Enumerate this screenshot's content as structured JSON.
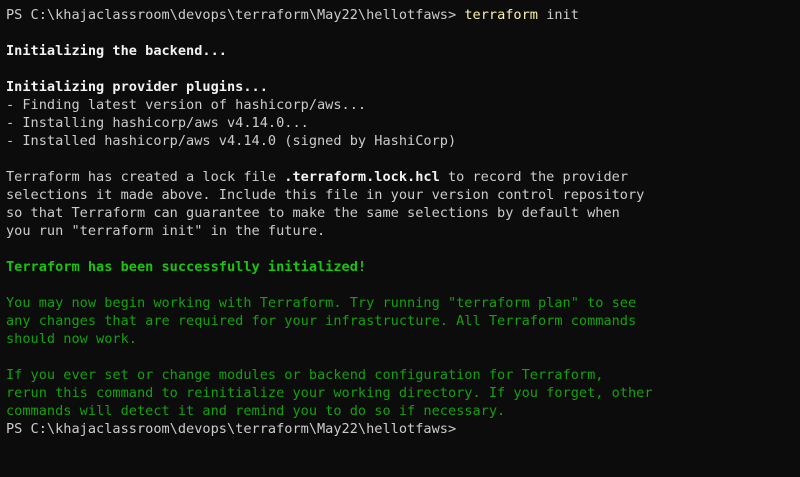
{
  "prompt1": "PS C:\\khajaclassroom\\devops\\terraform\\May22\\hellotfaws>",
  "command": "terraform",
  "command_args": "init",
  "init_backend": "Initializing the backend...",
  "init_provider": "Initializing provider plugins...",
  "finding": "- Finding latest version of hashicorp/aws...",
  "installing": "- Installing hashicorp/aws v4.14.0...",
  "installed": "- Installed hashicorp/aws v4.14.0 (signed by HashiCorp)",
  "lock_pre": "Terraform has created a lock file ",
  "lock_file": ".terraform.lock.hcl",
  "lock_post": " to record the provider",
  "lock2": "selections it made above. Include this file in your version control repository",
  "lock3": "so that Terraform can guarantee to make the same selections by default when",
  "lock4": "you run \"terraform init\" in the future.",
  "success": "Terraform has been successfully initialized!",
  "begin1": "You may now begin working with Terraform. Try running \"terraform plan\" to see",
  "begin2": "any changes that are required for your infrastructure. All Terraform commands",
  "begin3": "should now work.",
  "ever1": "If you ever set or change modules or backend configuration for Terraform,",
  "ever2": "rerun this command to reinitialize your working directory. If you forget, other",
  "ever3": "commands will detect it and remind you to do so if necessary.",
  "prompt2": "PS C:\\khajaclassroom\\devops\\terraform\\May22\\hellotfaws>"
}
